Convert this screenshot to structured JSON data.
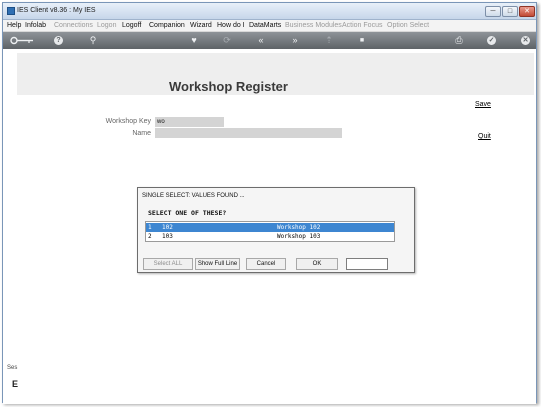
{
  "window": {
    "title": "IES Client v8.36 : My IES",
    "min": "─",
    "max": "□",
    "close": "✕"
  },
  "menu": [
    {
      "label": "Help",
      "enabled": true
    },
    {
      "label": "Infolab",
      "enabled": true
    },
    {
      "label": "Connections",
      "enabled": false
    },
    {
      "label": "Logon",
      "enabled": false
    },
    {
      "label": "Logoff",
      "enabled": true
    },
    {
      "label": "Companion",
      "enabled": true
    },
    {
      "label": "Wizard",
      "enabled": true
    },
    {
      "label": "How do I",
      "enabled": true
    },
    {
      "label": "DataMarts",
      "enabled": true
    },
    {
      "label": "Business Modules",
      "enabled": false
    },
    {
      "label": "Action Focus",
      "enabled": false
    },
    {
      "label": "Option Select",
      "enabled": false
    }
  ],
  "toolbar": {
    "key_icon": "key-icon",
    "help_icon": "?",
    "search_icon": "⚲",
    "heart_icon": "♥",
    "refresh_icon": "⟳",
    "back_icon": "«",
    "forward_icon": "»",
    "up_icon": "⇡",
    "stop_icon": "■",
    "print_icon": "⎙",
    "ok_icon": "✓",
    "exit_icon": "✕"
  },
  "page": {
    "title": "Workshop Register",
    "workshop_key_label": "Workshop Key",
    "workshop_key_value": "wo",
    "name_label": "Name",
    "name_value": "",
    "save_link": "Save",
    "quit_link": "Quit"
  },
  "sidebar": {
    "text": "Ses",
    "icon": "E"
  },
  "dialog": {
    "title": "SINGLE SELECT: VALUES FOUND ...",
    "prompt": "SELECT ONE OF THESE?",
    "rows": [
      {
        "num": "1",
        "code": "102",
        "name": "Workshop 102",
        "selected": true
      },
      {
        "num": "2",
        "code": "103",
        "name": "Workshop 103",
        "selected": false
      }
    ],
    "buttons": {
      "select_all": "Select ALL",
      "show_full_line": "Show Full Line",
      "cancel": "Cancel",
      "ok": "OK",
      "blank": ""
    }
  },
  "colors": {
    "selection": "#3d86d1",
    "toolbar": "#6e7377",
    "banner": "#eeeeee"
  }
}
